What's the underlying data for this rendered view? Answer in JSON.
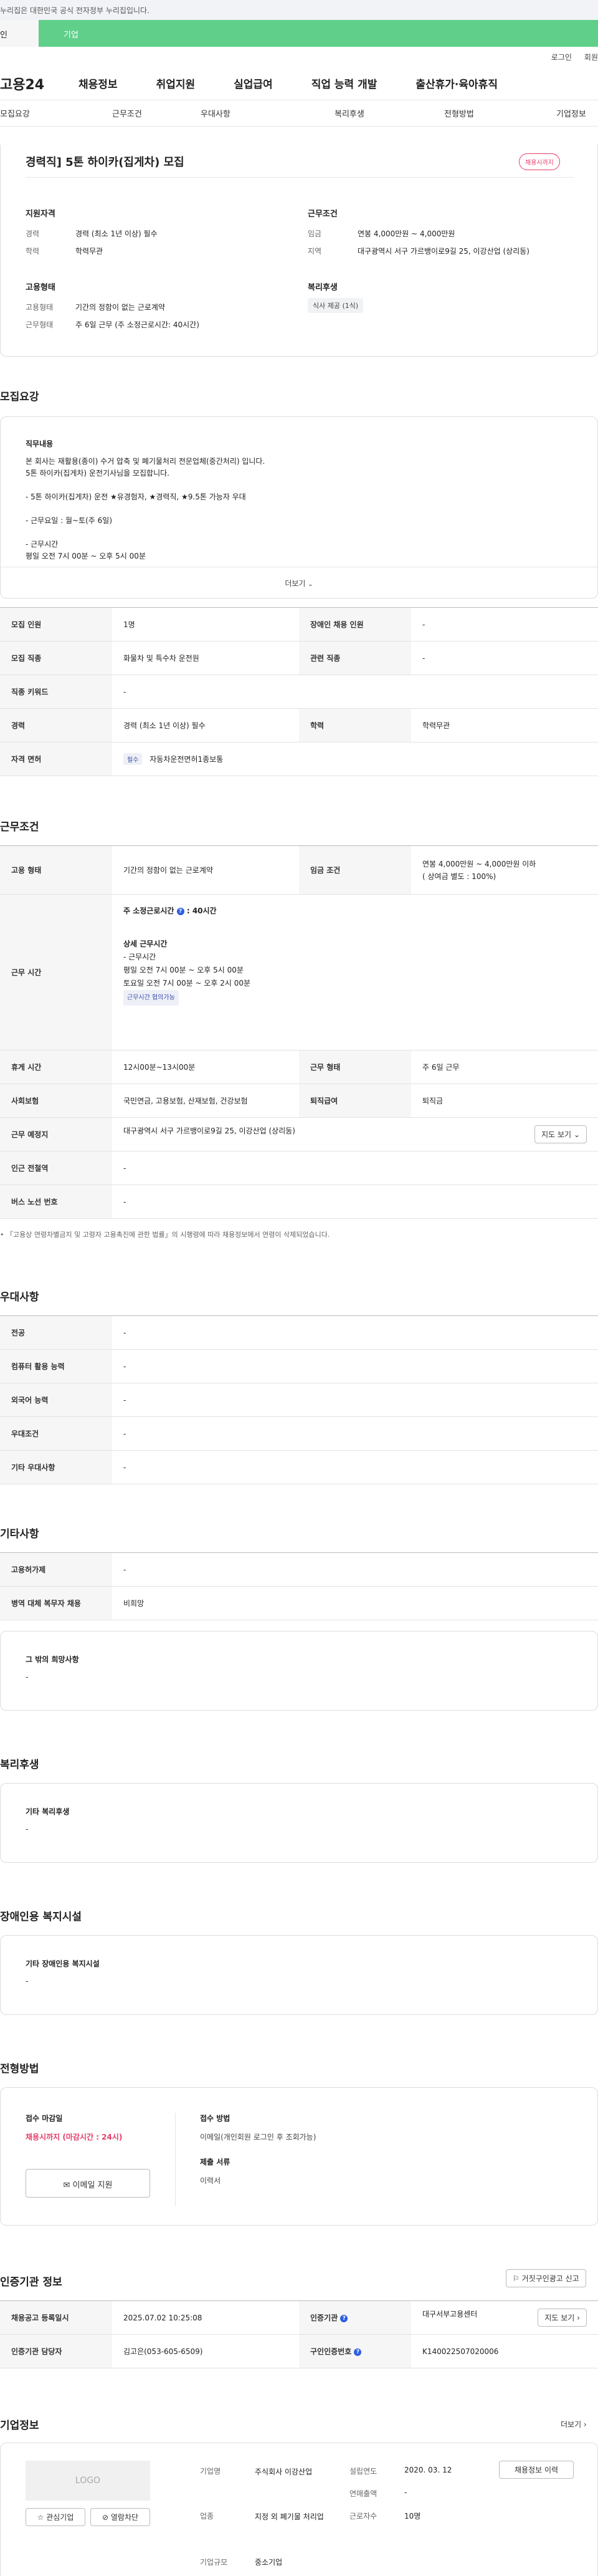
{
  "gov_banner": "누리집은 대한민국 공식 전자정부 누리집입니다.",
  "tabs": {
    "personal": "인",
    "corporate": "기업"
  },
  "util": {
    "login": "로그인",
    "join": "회원"
  },
  "gnb": {
    "logo": "고용24",
    "items": [
      "채용정보",
      "취업지원",
      "실업급여",
      "직업 능력 개발",
      "출산휴가·육아휴직"
    ]
  },
  "anchor_nav": [
    "모집요강",
    "근무조건",
    "우대사항",
    "복리후생",
    "전형방법",
    "기업정보"
  ],
  "summary": {
    "title": "경력직] 5톤 하이카(집게차) 모집",
    "status_badge": "채용시까지",
    "apply": {
      "heading": "지원자격",
      "rows": [
        {
          "label": "경력",
          "value": "경력 (최소 1년 이상) 필수"
        },
        {
          "label": "학력",
          "value": "학력무관"
        }
      ]
    },
    "work": {
      "heading": "근무조건",
      "rows": [
        {
          "label": "임금",
          "value": "연봉 4,000만원 ~ 4,000만원"
        },
        {
          "label": "지역",
          "value": "대구광역시 서구 가르뱅이로9길 25, 이강산업 (상리동)"
        }
      ]
    },
    "employ": {
      "heading": "고용형태",
      "rows": [
        {
          "label": "고용형태",
          "value": "기간의 정함이 없는 근로계약"
        },
        {
          "label": "근무형태",
          "value": "주 6일 근무 (주 소정근로시간: 40시간)"
        }
      ]
    },
    "welfare": {
      "heading": "복리후생",
      "tag": "식사 제공 (1식)"
    }
  },
  "recruit": {
    "title": "모집요강",
    "duty_label": "직무내용",
    "duty_lines": [
      "본 회사는 재활용(종이) 수거 압축 및 폐기물처리 전문업체(중간처리) 입니다.",
      "5톤 하이카(집게차) 운전기사님을 모집합니다.",
      "",
      "- 5톤 하이카(집게차) 운전 ★유경험자, ★경력직, ★9.5톤 가능자 우대",
      "",
      "- 근무요일 : 월~토(주 6일)",
      "",
      "- 근무시간",
      "평일 오전 7시 00분 ~ 오후 5시 00분"
    ],
    "more": "더보기",
    "table": [
      {
        "k1": "모집 인원",
        "v1": "1명",
        "k2": "장애인 채용 인원",
        "v2": "-"
      },
      {
        "k1": "모집 직종",
        "v1": "화물차 및 특수차 운전원",
        "k2": "관련 직종",
        "v2": "-"
      },
      {
        "k1": "직종 키워드",
        "v1": "-",
        "k2": "",
        "v2": ""
      },
      {
        "k1": "경력",
        "v1": "경력 (최소 1년 이상) 필수",
        "k2": "학력",
        "v2": "학력무관"
      },
      {
        "k1": "자격 면허",
        "v1": "자동차운전면허1종보통",
        "k2": "",
        "v2": ""
      }
    ],
    "license_tag": "필수"
  },
  "conditions": {
    "title": "근무조건",
    "employ_label": "고용 형태",
    "employ_value": "기간의 정함이 없는 근로계약",
    "wage_label": "임금 조건",
    "wage_value": "연봉 4,000만원 ~ 4,000만원 이하",
    "wage_note": "( 상여금 별도 : 100%)",
    "hours_label": "근무 시간",
    "hours_week": "주 소정근로시간",
    "hours_week_value": ": 40시간",
    "hours_detail_title": "상세 근무시간",
    "hours_detail": [
      "- 근무시간",
      "평일 오전 7시 00분 ~ 오후 5시 00분",
      "토요일 오전 7시 00분 ~ 오후 2시 00분"
    ],
    "hours_tag": "근무시간 협의가능",
    "rest_label": "휴게 시간",
    "rest_value": "12시00분~13시00분",
    "form_label": "근무 형태",
    "form_value": "주 6일 근무",
    "insure_label": "사회보험",
    "insure_value": "국민연금, 고용보험, 산재보험, 건강보험",
    "retire_label": "퇴직급여",
    "retire_value": "퇴직금",
    "place_label": "근무 예정지",
    "place_value": "대구광역시 서구 가르뱅이로9길 25, 이강산업 (상리동)",
    "map_btn": "지도 보기",
    "subway_label": "인근 전철역",
    "subway_value": "-",
    "bus_label": "버스 노선 번호",
    "bus_value": "-",
    "footnote": "「고용상 연령차별금지 및 고령자 고용촉진에 관한 법률」의 시행령에 따라 채용정보에서 연령이 삭제되었습니다."
  },
  "preference": {
    "title": "우대사항",
    "rows": [
      {
        "k": "전공",
        "v": "-"
      },
      {
        "k": "컴퓨터 활용 능력",
        "v": "-"
      },
      {
        "k": "외국어 능력",
        "v": "-"
      },
      {
        "k": "우대조건",
        "v": "-"
      },
      {
        "k": "기타 우대사항",
        "v": "-"
      }
    ]
  },
  "etc": {
    "title": "기타사항",
    "rows": [
      {
        "k": "고용허가제",
        "v": "-"
      },
      {
        "k": "병역 대체 복무자 채용",
        "v": "비희망"
      }
    ],
    "other_label": "그 밖의 희망사항",
    "other_value": "-"
  },
  "welfare": {
    "title": "복리후생",
    "label": "기타 복리후생",
    "value": "-"
  },
  "disabled": {
    "title": "장애인용 복지시설",
    "label": "기타 장애인용 복지시설",
    "value": "-"
  },
  "selection": {
    "title": "전형방법",
    "deadline_label": "접수 마감일",
    "deadline_value": "채용시까지 (마감시간 : 24시)",
    "email_btn": "이메일 지원",
    "method_label": "접수 방법",
    "method_value": "이메일(개인회원 로그인 후 조회가능)",
    "docs_label": "제출 서류",
    "docs_value": "이력서"
  },
  "agency": {
    "title": "인증기관 정보",
    "report_btn": "거짓구인광고 신고",
    "rows": [
      {
        "k1": "채용공고 등록일시",
        "v1": "2025.07.02 10:25:08",
        "k2": "인증기관",
        "v2": "대구서부고용센터",
        "btn": "지도 보기"
      },
      {
        "k1": "인증기관 담당자",
        "v1": "김고은(053-605-6509)",
        "k2": "구인인증번호",
        "v2": "K140022507020006",
        "btn": ""
      }
    ]
  },
  "company": {
    "title": "기업정보",
    "more": "더보기",
    "logo_text": "LOGO",
    "interest_btn": "관심기업",
    "block_btn": "열람차단",
    "name_label": "기업명",
    "name_value": "주식회사 이강산업",
    "industry_label": "업종",
    "industry_value": "지정 외 폐기물 처리업",
    "size_label": "기업규모",
    "size_value": "중소기업",
    "founded_label": "설립연도",
    "founded_value": "2020. 03. 12",
    "sales_label": "연매출액",
    "sales_value": "-",
    "emp_label": "근로자수",
    "emp_value": "10명",
    "jobs_btn": "채용정보 이력"
  }
}
